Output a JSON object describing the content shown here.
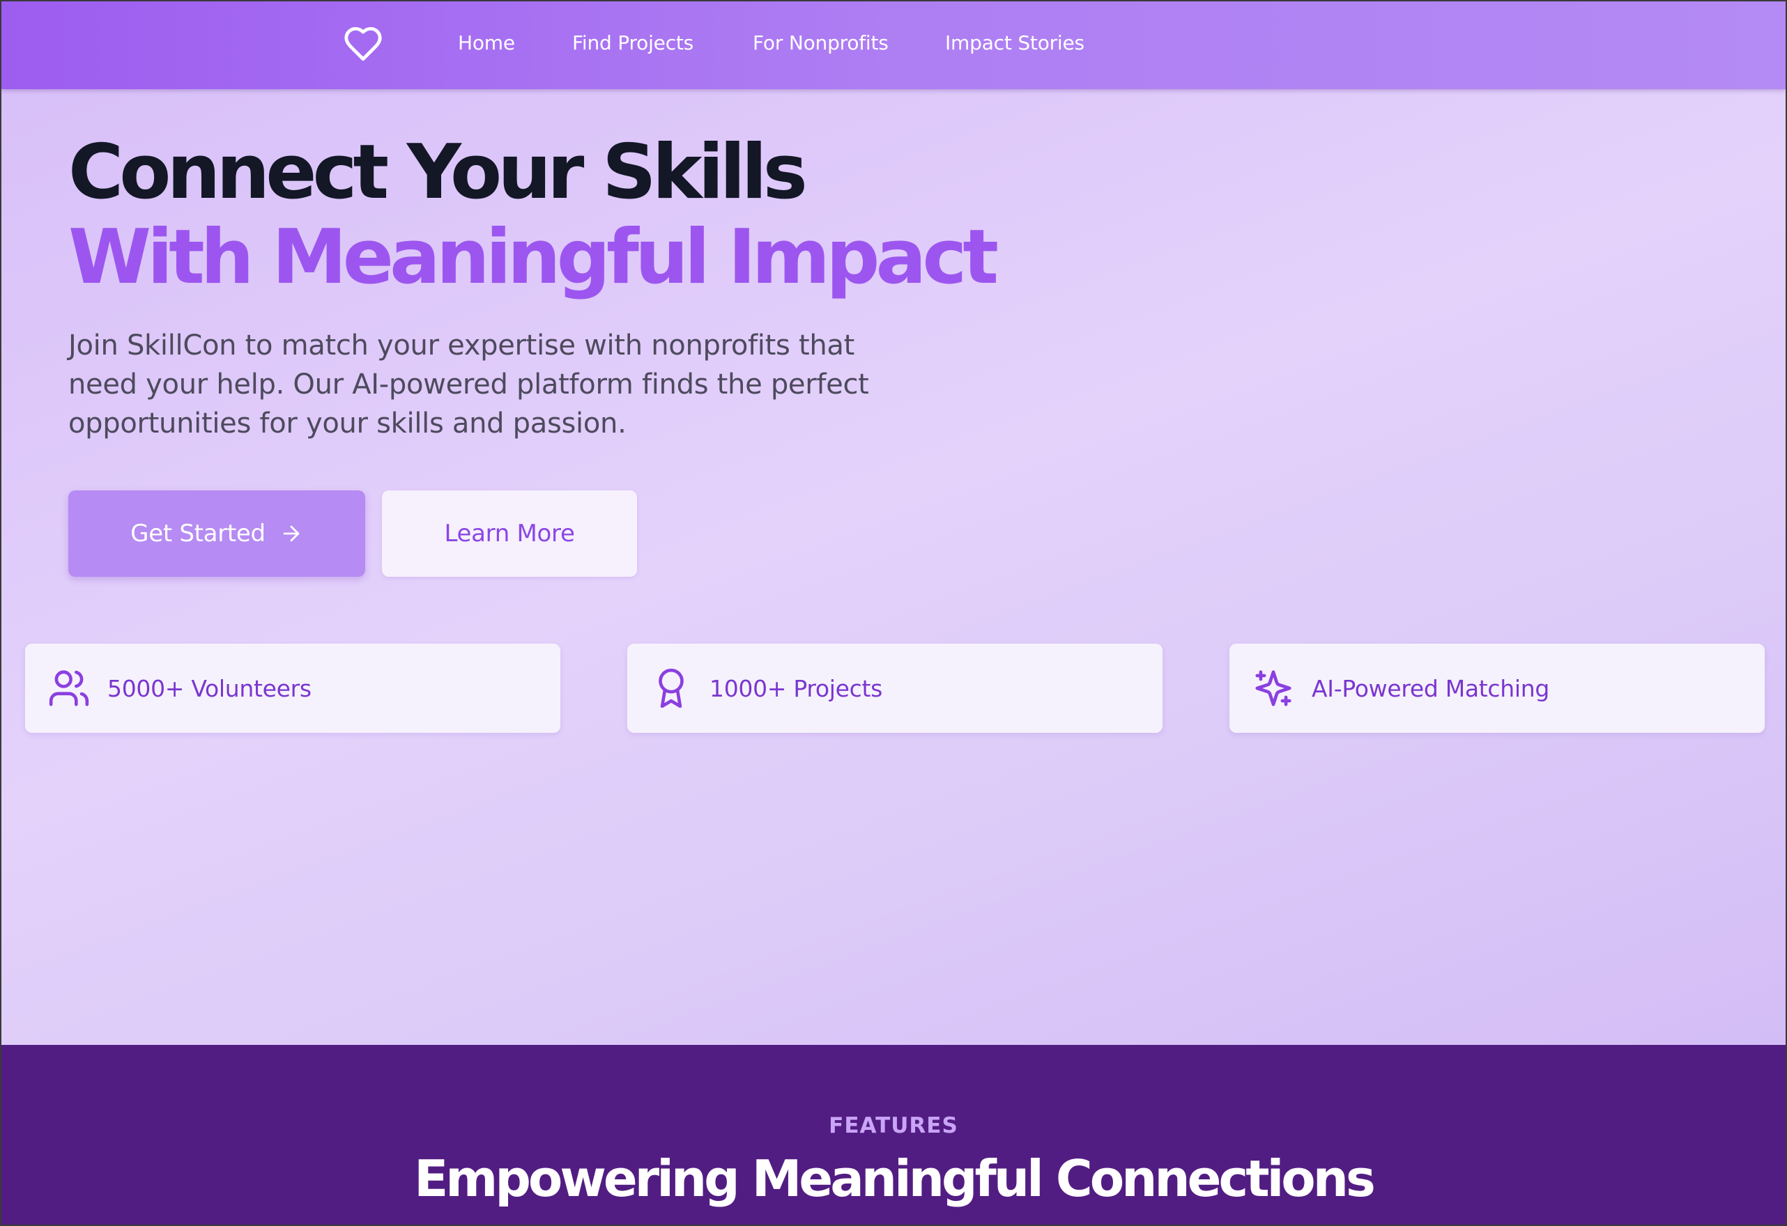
{
  "nav": {
    "logo_icon": "heart-icon",
    "links": [
      "Home",
      "Find Projects",
      "For Nonprofits",
      "Impact Stories"
    ]
  },
  "hero": {
    "title_line1": "Connect Your Skills",
    "title_line2": "With Meaningful Impact",
    "description": "Join SkillCon to match your expertise with nonprofits that need your help. Our AI-powered platform finds the perfect opportunities for your skills and passion.",
    "primary_button": "Get Started",
    "primary_button_icon": "arrow-right-icon",
    "secondary_button": "Learn More"
  },
  "stats": [
    {
      "icon": "users-icon",
      "label": "5000+ Volunteers"
    },
    {
      "icon": "award-icon",
      "label": "1000+ Projects"
    },
    {
      "icon": "sparkles-icon",
      "label": "AI-Powered Matching"
    }
  ],
  "features": {
    "eyebrow": "FEATURES",
    "title": "Empowering Meaningful Connections"
  },
  "colors": {
    "nav_gradient_start": "#9d5df0",
    "nav_gradient_end": "#b48af4",
    "accent": "#9c56ef",
    "heading": "#131726",
    "features_bg": "#521d82"
  }
}
